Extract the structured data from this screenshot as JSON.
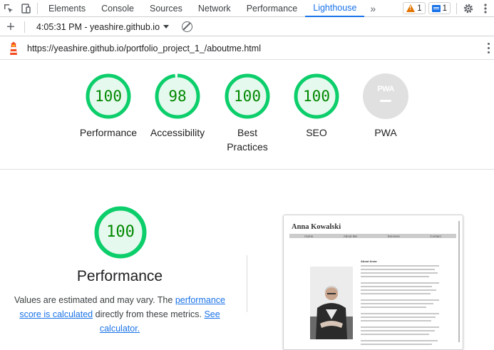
{
  "devtools": {
    "tabs": [
      "Elements",
      "Console",
      "Sources",
      "Network",
      "Performance",
      "Lighthouse"
    ],
    "active_tab": "Lighthouse",
    "more_tabs_glyph": "»",
    "warnings_count": "1",
    "messages_count": "1",
    "icons": [
      "inspect-element-icon",
      "device-toolbar-icon",
      "more-tabs-icon",
      "warning-icon",
      "message-icon",
      "settings-gear-icon",
      "kebab-menu-icon"
    ]
  },
  "lighthouse_toolbar": {
    "new_report_glyph": "+",
    "report_selector": "4:05:31 PM - yeashire.github.io",
    "icons": [
      "plus-icon",
      "dropdown-caret-icon",
      "clear-all-icon"
    ]
  },
  "urlbar": {
    "url": "https://yeashire.github.io/portfolio_project_1_/aboutme.html",
    "icons": [
      "lighthouse-logo-icon",
      "kebab-menu-icon"
    ]
  },
  "scores": [
    {
      "label": "Performance",
      "value": "100",
      "fraction": 1.0
    },
    {
      "label": "Accessibility",
      "value": "98",
      "fraction": 0.98
    },
    {
      "label": "Best Practices",
      "value": "100",
      "fraction": 1.0
    },
    {
      "label": "SEO",
      "value": "100",
      "fraction": 1.0
    }
  ],
  "pwa": {
    "label": "PWA",
    "badge": "PWA"
  },
  "colors": {
    "pass_ring": "#0cce6b",
    "pass_fill": "#e6f9ee",
    "pass_text": "#008800",
    "accent": "#1a73e8",
    "warning": "#e37400"
  },
  "performance_section": {
    "score": "100",
    "fraction": 1.0,
    "title": "Performance",
    "desc_1": "Values are estimated and may vary. The ",
    "link_1": "performance score is calculated",
    "desc_2": " directly from these metrics. ",
    "link_2": "See calculator."
  },
  "thumbnail": {
    "site_name": "Anna Kowalski",
    "nav": [
      "Home",
      "About Me",
      "Services",
      "Contact"
    ],
    "heading": "About Anna"
  }
}
